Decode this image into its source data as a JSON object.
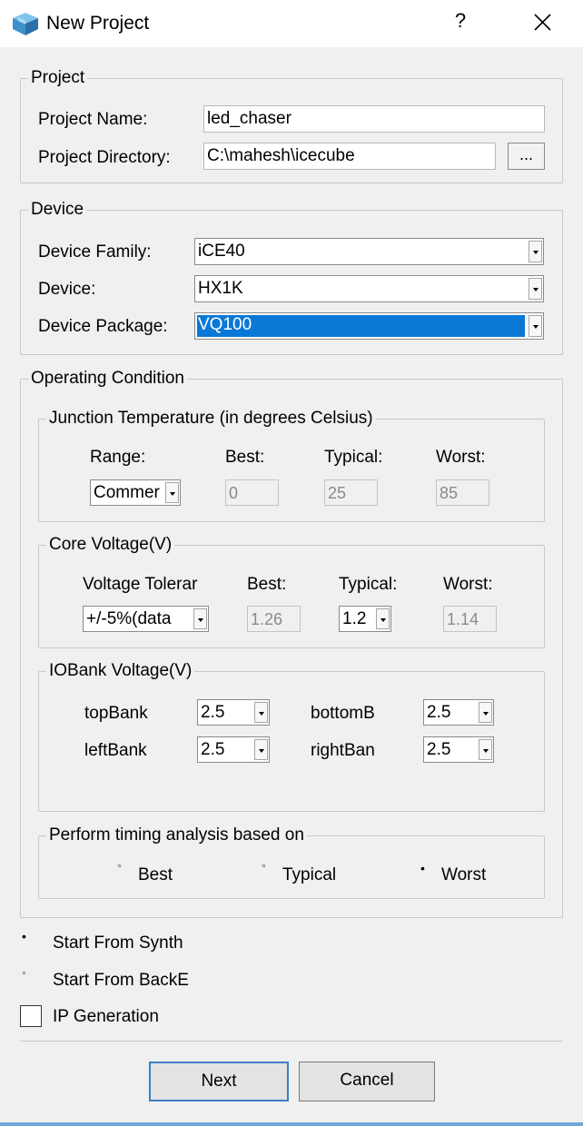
{
  "window": {
    "title": "New Project",
    "help_label": "?",
    "close_icon": "close-icon"
  },
  "project": {
    "legend": "Project",
    "name_label": "Project Name:",
    "name_value": "led_chaser",
    "dir_label": "Project Directory:",
    "dir_value": "C:\\mahesh\\icecube",
    "browse_label": "..."
  },
  "device": {
    "legend": "Device",
    "family_label": "Device Family:",
    "family_value": "iCE40",
    "device_label": "Device:",
    "device_value": "HX1K",
    "package_label": "Device Package:",
    "package_value": "VQ100"
  },
  "operating": {
    "legend": "Operating Condition",
    "junction": {
      "legend": "Junction Temperature (in degrees Celsius)",
      "range_label": "Range:",
      "best_label": "Best:",
      "typical_label": "Typical:",
      "worst_label": "Worst:",
      "range_value": "Commer",
      "best_value": "0",
      "typical_value": "25",
      "worst_value": "85"
    },
    "core": {
      "legend": "Core Voltage(V)",
      "tolerance_label": "Voltage Tolerar",
      "best_label": "Best:",
      "typical_label": "Typical:",
      "worst_label": "Worst:",
      "tolerance_value": "+/-5%(data",
      "best_value": "1.26",
      "typical_value": "1.2",
      "worst_value": "1.14"
    },
    "iobank": {
      "legend": "IOBank Voltage(V)",
      "top_label": "topBank",
      "top_value": "2.5",
      "bottom_label": "bottomB",
      "bottom_value": "2.5",
      "left_label": "leftBank",
      "left_value": "2.5",
      "right_label": "rightBan",
      "right_value": "2.5"
    },
    "timing": {
      "legend": "Perform timing analysis based on",
      "best_label": "Best",
      "typical_label": "Typical",
      "worst_label": "Worst",
      "selected": "Worst",
      "radio_selected_glyph": "•",
      "radio_unselected_glyph": "°"
    }
  },
  "start": {
    "synth_label": "Start From Synth",
    "backend_label": "Start From BackE",
    "selected": "synth"
  },
  "ip_generation": {
    "label": "IP Generation",
    "checked": false
  },
  "buttons": {
    "next_label": "Next",
    "cancel_label": "Cancel"
  },
  "colors": {
    "selection": "#0a78d7",
    "dialog_bg": "#f0f0f0"
  }
}
